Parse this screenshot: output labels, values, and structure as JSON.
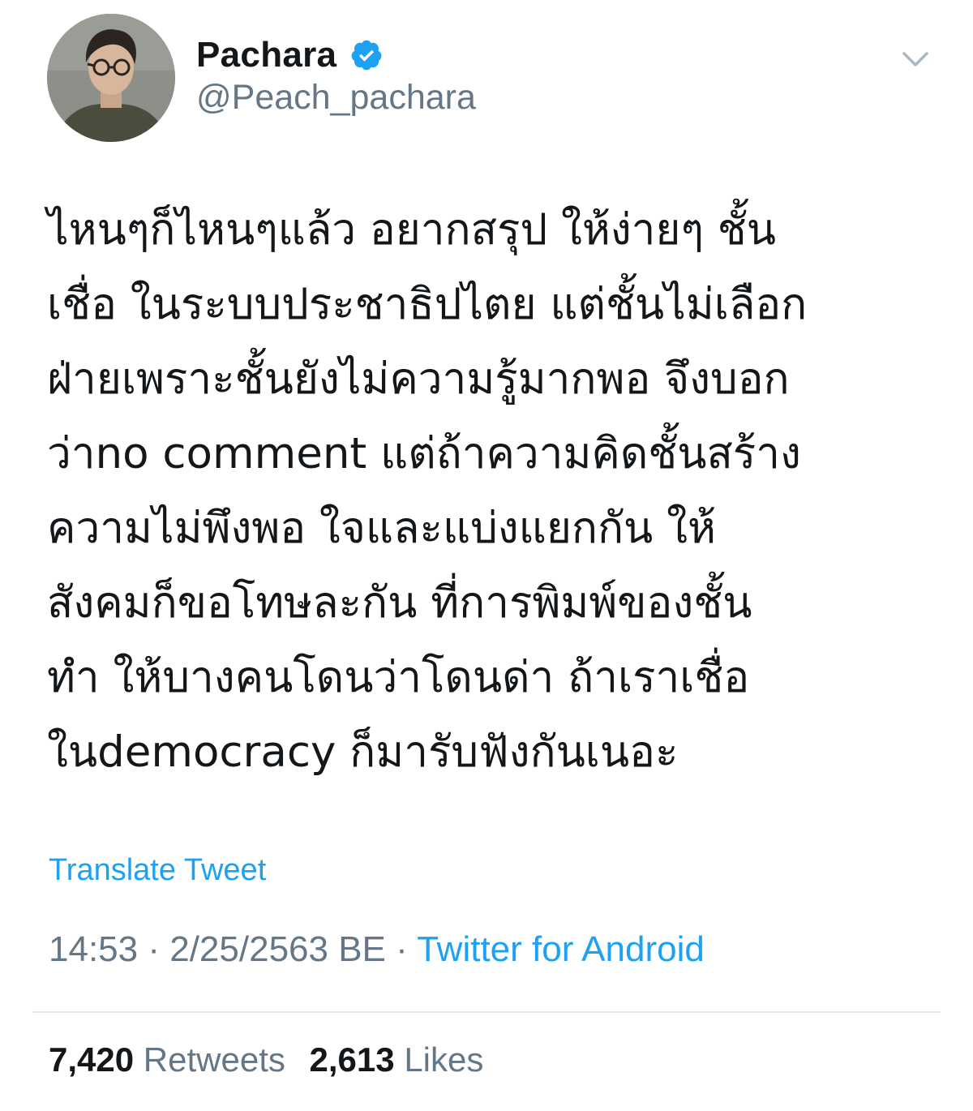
{
  "author": {
    "display_name": "Pachara",
    "handle": "@Peach_pachara",
    "verified": true,
    "avatar_icon": "profile-photo"
  },
  "tweet": {
    "text": "ไหนๆก็ไหนๆแล้ว อยากสรุป ให้ง่ายๆ ชั้น\nเชื่อ ในระบบประชาธิปไตย แต่ชั้นไม่เลือก\nฝ่ายเพราะชั้นยังไม่ความรู้มากพอ จึงบอก\nว่าno comment แต่ถ้าความคิดชั้นสร้าง\nความไม่พึงพอ ใจและแบ่งแยกกัน ให้\nสังคมก็ขอโทษละกัน ที่การพิมพ์ของชั้น\nทำ ให้บางคนโดนว่าโดนด่า ถ้าเราเชื่อ\nในdemocracy ก็มารับฟังกันเนอะ",
    "translate_label": "Translate Tweet",
    "time": "14:53",
    "date": "2/25/2563 BE",
    "separator": "·",
    "source": "Twitter for Android"
  },
  "stats": {
    "retweets_count": "7,420",
    "retweets_label": "Retweets",
    "likes_count": "2,613",
    "likes_label": "Likes"
  },
  "colors": {
    "accent": "#1da1f2",
    "secondary_text": "#657786",
    "primary_text": "#14171a",
    "divider": "#e1e8ed"
  }
}
